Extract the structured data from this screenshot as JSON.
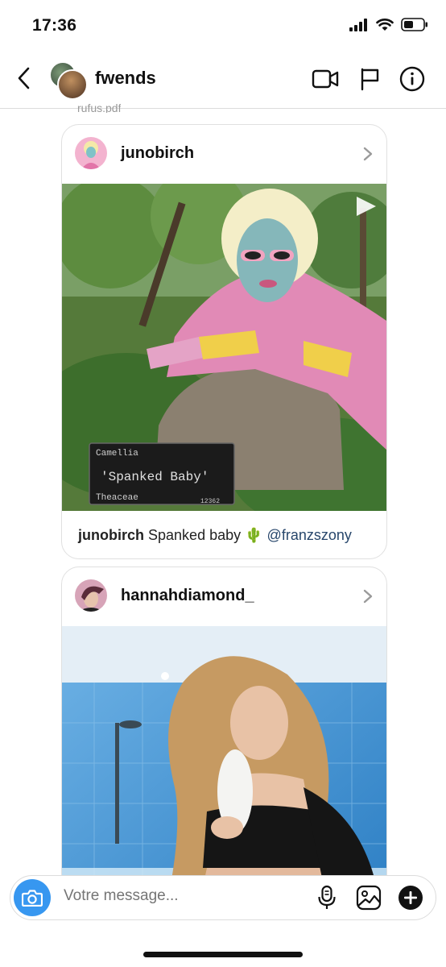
{
  "status_bar": {
    "time": "17:36"
  },
  "header": {
    "title": "fwends"
  },
  "previous_sender": "rufus.pdf",
  "posts": [
    {
      "username": "junobirch",
      "caption_user": "junobirch",
      "caption_text": "Spanked baby 🌵",
      "caption_mention": "@franzszony",
      "sign": {
        "top": "Camellia",
        "main": "'Spanked Baby'",
        "bottom": "Theaceae",
        "code": "12362"
      }
    },
    {
      "username": "hannahdiamond_"
    }
  ],
  "composer": {
    "placeholder": "Votre message..."
  },
  "colors": {
    "accent": "#3797f0",
    "mention": "#27466b"
  }
}
